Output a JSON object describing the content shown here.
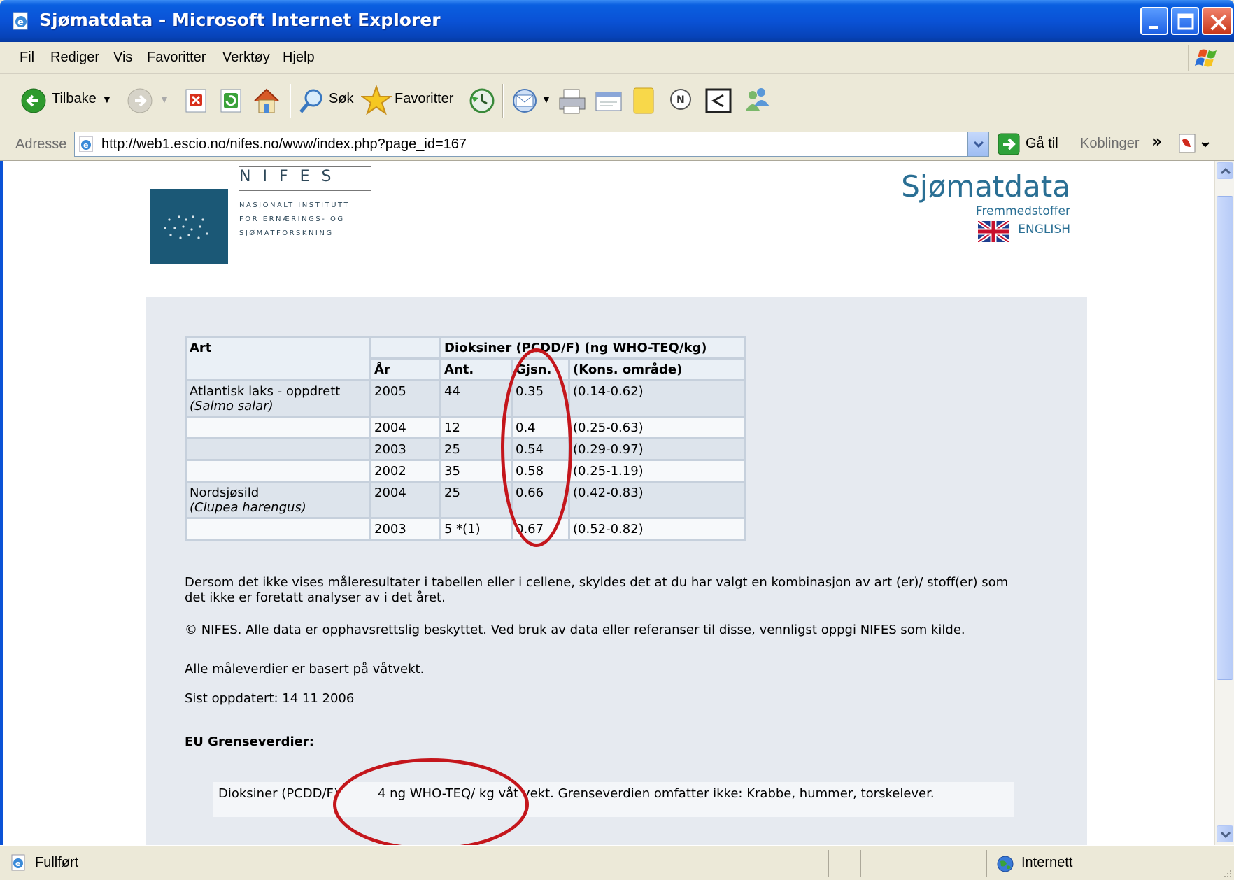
{
  "window": {
    "title": "Sjømatdata - Microsoft Internet Explorer"
  },
  "menu": [
    "Fil",
    "Rediger",
    "Vis",
    "Favoritter",
    "Verktøy",
    "Hjelp"
  ],
  "toolbar": {
    "back_label": "Tilbake",
    "search_label": "Søk",
    "favorites_label": "Favoritter"
  },
  "addressbar": {
    "label": "Adresse",
    "url": "http://web1.escio.no/nifes.no/www/index.php?page_id=167",
    "go_label": "Gå til",
    "links_label": "Koblinger",
    "more": "»"
  },
  "header": {
    "logo_letters": "NIFES",
    "logo_lines": [
      "NASJONALT INSTITUTT",
      "FOR ERNÆRINGS- OG",
      "SJØMATFORSKNING"
    ],
    "site_title": "Sjømatdata",
    "site_subtitle": "Fremmedstoffer",
    "language_link": "ENGLISH"
  },
  "table": {
    "headers": {
      "art": "Art",
      "substance": "Dioksiner (PCDD/F) (ng WHO-TEQ/kg)",
      "year": "År",
      "count": "Ant.",
      "mean": "Gjsn.",
      "range": "(Kons. område)"
    },
    "rows": [
      {
        "species": "Atlantisk laks - oppdrett",
        "latin": "(Salmo salar)",
        "year": "2005",
        "count": "44",
        "mean": "0.35",
        "range": "(0.14-0.62)"
      },
      {
        "species": "",
        "latin": "",
        "year": "2004",
        "count": "12",
        "mean": "0.4",
        "range": "(0.25-0.63)"
      },
      {
        "species": "",
        "latin": "",
        "year": "2003",
        "count": "25",
        "mean": "0.54",
        "range": "(0.29-0.97)"
      },
      {
        "species": "",
        "latin": "",
        "year": "2002",
        "count": "35",
        "mean": "0.58",
        "range": "(0.25-1.19)"
      },
      {
        "species": "Nordsjøsild",
        "latin": "(Clupea harengus)",
        "year": "2004",
        "count": "25",
        "mean": "0.66",
        "range": "(0.42-0.83)"
      },
      {
        "species": "",
        "latin": "",
        "year": "2003",
        "count": "5 *(1)",
        "mean": "0.67",
        "range": "(0.52-0.82)"
      }
    ]
  },
  "notes": {
    "empty_note": "Dersom det ikke vises måleresultater i tabellen eller i cellene, skyldes det at du har valgt en kombinasjon av art (er)/ stoff(er) som det ikke er foretatt analyser av i det året.",
    "copyright": "© NIFES. Alle data er opphavsrettslig beskyttet. Ved bruk av data eller referanser til disse, vennligst oppgi NIFES som kilde.",
    "wet_weight": "Alle måleverdier er basert på våtvekt.",
    "updated": "Sist oppdatert: 14 11 2006"
  },
  "eu": {
    "title": "EU Grenseverdier:",
    "substance": "Dioksiner (PCDD/F)",
    "limit": "4 ng WHO-TEQ/ kg våt vekt. Grenseverdien omfatter ikke: Krabbe, hummer, torskelever."
  },
  "statusbar": {
    "status": "Fullført",
    "zone": "Internett"
  },
  "colors": {
    "title_bar": "#0a52d6",
    "brand": "#2a6f94",
    "annotation": "#c4161c",
    "panel": "#e6eaf0"
  }
}
